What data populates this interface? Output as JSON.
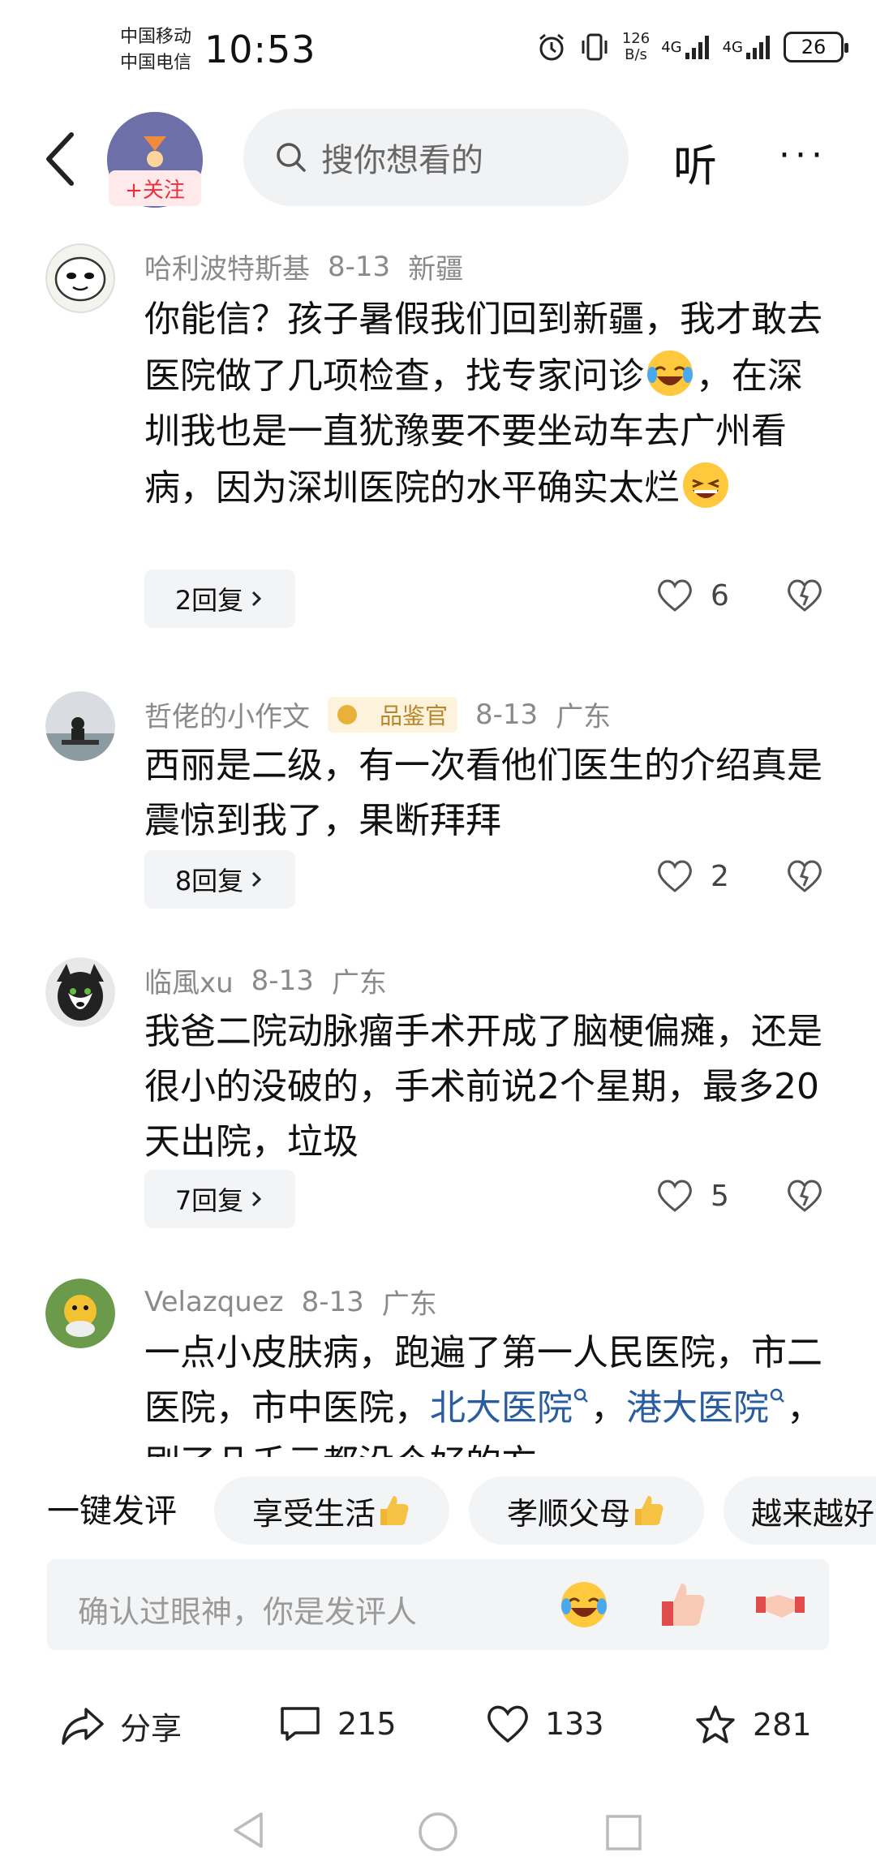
{
  "status_bar": {
    "carrier_1": "中国移动",
    "carrier_2": "中国电信",
    "time": "10:53",
    "net_speed_value": "126",
    "net_speed_unit": "B/s",
    "signal_1_label": "4G",
    "signal_2_label": "4G",
    "battery": "26"
  },
  "header": {
    "follow_label": "+关注",
    "search_placeholder": "搜你想看的",
    "listen_label": "听",
    "more_label": "···"
  },
  "comments": [
    {
      "user": "哈利波特斯基",
      "date": "8-13",
      "location": "新疆",
      "text_part1": "你能信？孩子暑假我们回到新疆，我才敢去医院做了几项检查，找专家问诊",
      "text_part2": "，在深圳我也是一直犹豫要不要坐动车去广州看病，因为深圳医院的水平确实太烂",
      "replies": "2回复",
      "likes": "6"
    },
    {
      "user": "哲佬的小作文",
      "badge": "品鉴官",
      "date": "8-13",
      "location": "广东",
      "text": "西丽是二级，有一次看他们医生的介绍真是震惊到我了，果断拜拜",
      "replies": "8回复",
      "likes": "2"
    },
    {
      "user": "临風xu",
      "date": "8-13",
      "location": "广东",
      "text": "我爸二院动脉瘤手术开成了脑梗偏瘫，还是很小的没破的，手术前说2个星期，最多20天出院，垃圾",
      "replies": "7回复",
      "likes": "5"
    },
    {
      "user": "Velazquez",
      "date": "8-13",
      "location": "广东",
      "text_part1": "一点小皮肤病，跑遍了第一人民医院，市二医院，市中医院，",
      "link_1": "北大医院",
      "text_part2": "，",
      "link_2": "港大医院",
      "text_part3": "，刷了几千元都没个好的方"
    }
  ],
  "quick_reply": {
    "label": "一键发评",
    "chips": [
      "享受生活",
      "孝顺父母",
      "越来越好"
    ]
  },
  "input": {
    "placeholder": "确认过眼神，你是发评人"
  },
  "actions": {
    "share_label": "分享",
    "comments_count": "215",
    "likes_count": "133",
    "favorites_count": "281"
  }
}
